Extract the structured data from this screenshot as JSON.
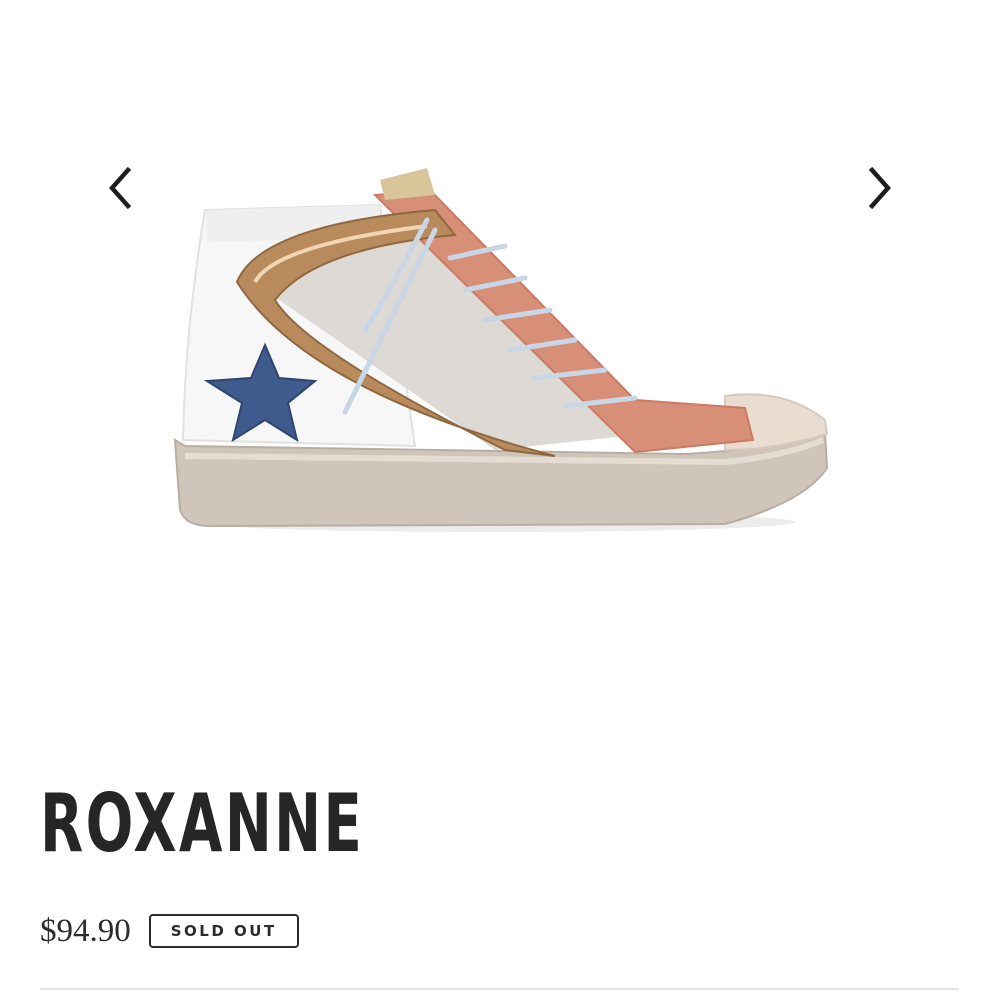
{
  "product": {
    "title": "ROXANNE",
    "price": "$94.90",
    "status_badge": "SOLD OUT"
  },
  "gallery": {
    "prev_icon": "chevron-left-icon",
    "next_icon": "chevron-right-icon"
  },
  "colors": {
    "text": "#262626",
    "divider": "#e3e3e3",
    "star": "#3f5b8e",
    "suede": "#d88f78",
    "metallic": "#b98a5c"
  }
}
